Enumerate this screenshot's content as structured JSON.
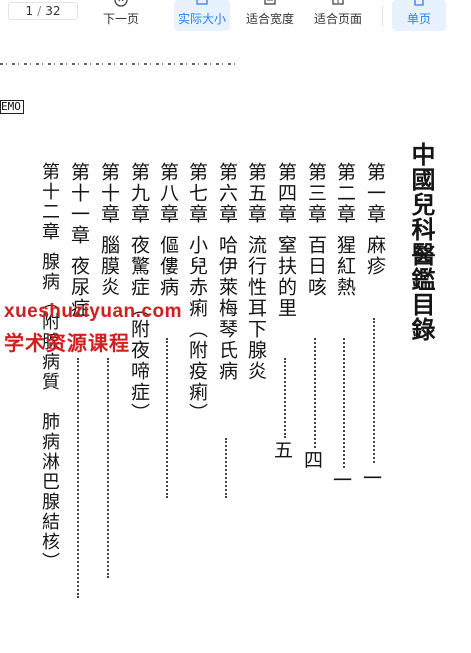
{
  "toolbar": {
    "page_current": "1",
    "page_sep": "/",
    "page_total": "32",
    "next_label": "下一页",
    "actual_size_label": "实际大小",
    "fit_width_label": "适合宽度",
    "fit_page_label": "适合页面",
    "single_page_label": "单页",
    "accent_color": "#2d7ff9",
    "active_bg": "#e8f2ff"
  },
  "document": {
    "memo": "EMO",
    "title": "中國兒科醫鑑目錄",
    "chapters": [
      {
        "label": "第一章",
        "text": "麻疹"
      },
      {
        "label": "第二章",
        "text": "猩紅熱"
      },
      {
        "label": "第三章",
        "text": "百日咳"
      },
      {
        "label": "第四章",
        "text": "窒扶的里"
      },
      {
        "label": "第五章",
        "text": "流行性耳下腺炎"
      },
      {
        "label": "第六章",
        "text": "哈伊萊梅琴氏病"
      },
      {
        "label": "第七章",
        "text": "小兒赤痢（附疫痢）"
      },
      {
        "label": "第八章",
        "text": "傴僂病"
      },
      {
        "label": "第九章",
        "text": "夜驚症（附夜啼症）"
      },
      {
        "label": "第十章",
        "text": "腦膜炎"
      },
      {
        "label": "第十一章",
        "text": "夜尿症"
      },
      {
        "label": "第十二章",
        "text": "腺病（附腺病質　肺病淋巴腺結核）"
      }
    ],
    "page_numbers": [
      "一",
      "一",
      "四",
      "五"
    ]
  },
  "watermark": {
    "line1": "xueshuziyuan.com",
    "line2": "学术资源课程",
    "color": "#d21e1e"
  }
}
